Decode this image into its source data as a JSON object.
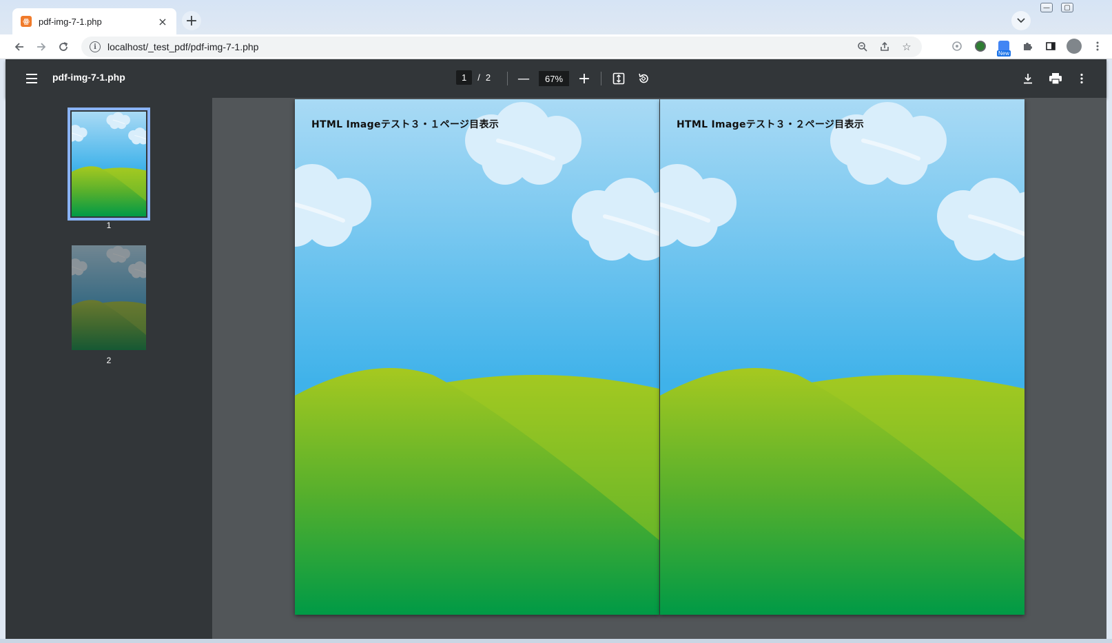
{
  "browser": {
    "tab_title": "pdf-img-7-1.php",
    "tab_close": "×",
    "new_tab": "+",
    "url": "localhost/_test_pdf/pdf-img-7-1.php",
    "extension_badge": "New"
  },
  "window_controls": {
    "minimize": "—",
    "maximize": "▢",
    "close": "✕"
  },
  "pdf_viewer": {
    "title": "pdf-img-7-1.php",
    "current_page": "1",
    "page_separator": "/",
    "total_pages": "2",
    "zoom": "67%",
    "zoom_out": "—",
    "zoom_in": "+"
  },
  "thumbnails": [
    {
      "label": "1",
      "selected": true
    },
    {
      "label": "2",
      "selected": false
    }
  ],
  "pages": [
    {
      "heading": "HTML Imageテスト３・１ページ目表示"
    },
    {
      "heading": "HTML Imageテスト３・２ページ目表示"
    }
  ],
  "colors": {
    "sky_top": "#a8d8f4",
    "sky_bottom": "#3fb2ea",
    "hill_light": "#a3c921",
    "hill_dark": "#009a46",
    "toolbar": "#323639",
    "canvas": "#525659",
    "accent": "#8ab4f8"
  }
}
